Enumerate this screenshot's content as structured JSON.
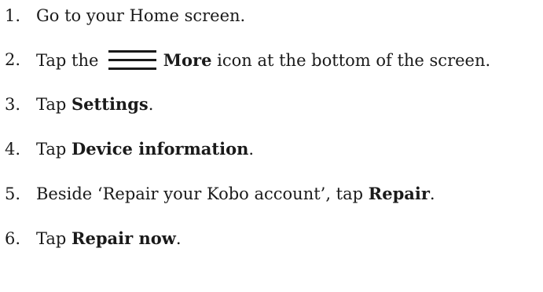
{
  "steps": [
    {
      "number": "1.",
      "text": "Go to your Home screen."
    },
    {
      "number": "2.",
      "pre": "Tap the ",
      "icon": "hamburger-menu-icon",
      "bold": "More",
      "post": " icon at the bottom of the screen."
    },
    {
      "number": "3.",
      "pre": "Tap ",
      "bold": "Settings",
      "post": "."
    },
    {
      "number": "4.",
      "pre": "Tap ",
      "bold": "Device information",
      "post": "."
    },
    {
      "number": "5.",
      "pre": "Beside ‘Repair your Kobo account’, tap ",
      "bold": "Repair",
      "post": "."
    },
    {
      "number": "6.",
      "pre": "Tap ",
      "bold": "Repair now",
      "post": "."
    }
  ]
}
